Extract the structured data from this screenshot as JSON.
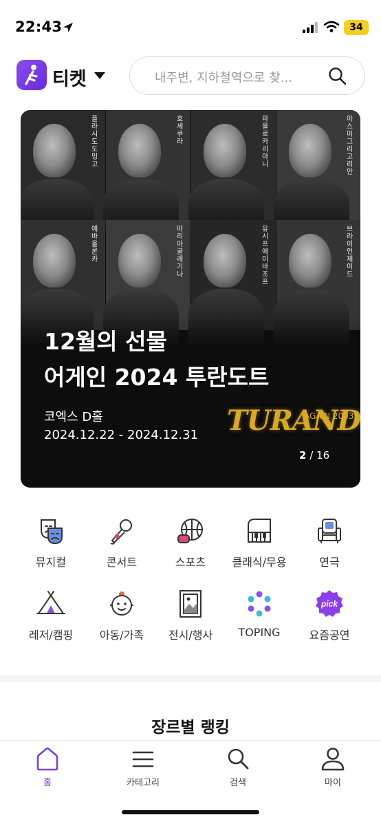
{
  "status_bar": {
    "time": "22:43",
    "battery": "34"
  },
  "header": {
    "app_title": "티켓",
    "search_placeholder": "내주변, 지하철역으로 찾..."
  },
  "banner": {
    "performers": [
      "플라시도 도밍고",
      "호세 쿠라",
      "파올로 카리아니",
      "아스미 그리고리안",
      "예바 올론카",
      "마리아 굴레기나",
      "유시프 에이바조프",
      "브라이언 제이드"
    ],
    "title_line1": "12월의 선물",
    "title_line2": "어게인 2024 투란도트",
    "venue": "코엑스 D홀",
    "dates": "2024.12.22 - 2024.12.31",
    "logo_text": "TURANDOT",
    "logo_sub": "AGAIN 2003",
    "slide_current": "2",
    "slide_total": "16"
  },
  "categories": [
    {
      "label": "뮤지컬",
      "icon": "musical-mask-icon"
    },
    {
      "label": "콘서트",
      "icon": "microphone-icon"
    },
    {
      "label": "스포츠",
      "icon": "basketball-icon"
    },
    {
      "label": "클래식/무용",
      "icon": "piano-icon"
    },
    {
      "label": "연극",
      "icon": "theater-seat-icon"
    },
    {
      "label": "레저/캠핑",
      "icon": "tent-icon"
    },
    {
      "label": "아동/가족",
      "icon": "child-face-icon"
    },
    {
      "label": "전시/행사",
      "icon": "picture-frame-icon"
    },
    {
      "label": "TOPING",
      "icon": "toping-dots-icon"
    },
    {
      "label": "요즘공연",
      "icon": "pick-badge-icon"
    }
  ],
  "pick_badge_text": "pick",
  "section_title": "장르별 랭킹",
  "bottom_nav": [
    {
      "label": "홈",
      "icon": "home-icon",
      "active": true
    },
    {
      "label": "카테고리",
      "icon": "menu-icon",
      "active": false
    },
    {
      "label": "검색",
      "icon": "search-icon",
      "active": false
    },
    {
      "label": "마이",
      "icon": "user-icon",
      "active": false
    }
  ],
  "colors": {
    "accent": "#7b3fe4",
    "banner_bg": "#0d0d0d",
    "logo_gold": "#d9a826",
    "battery": "#f3d020"
  }
}
